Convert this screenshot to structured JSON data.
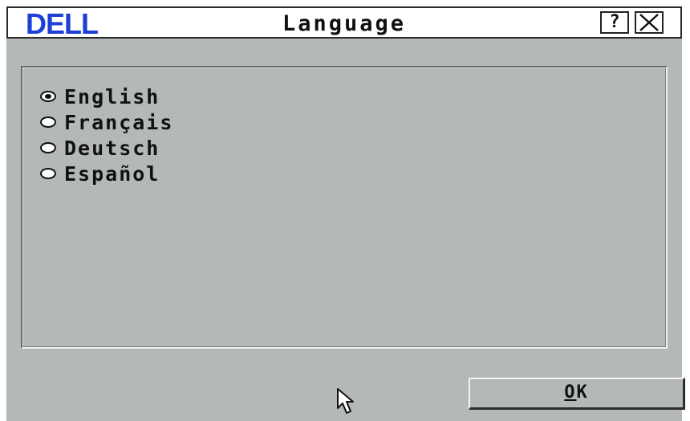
{
  "window": {
    "title": "Language",
    "logo_text": "DELL",
    "help_label": "?",
    "close_label": "✕"
  },
  "languages": [
    {
      "label": "English",
      "selected": true
    },
    {
      "label": "Français",
      "selected": false
    },
    {
      "label": "Deutsch",
      "selected": false
    },
    {
      "label": "Español",
      "selected": false
    }
  ],
  "buttons": {
    "ok_label_underlined": "O",
    "ok_label_rest": "K"
  },
  "colors": {
    "logo_blue": "#1c3fd6",
    "dialog_bg": "#b4b8b8"
  }
}
